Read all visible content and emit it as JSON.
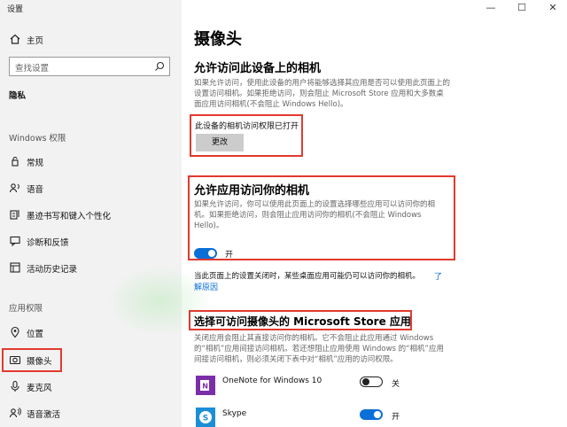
{
  "window": {
    "title": "设置",
    "minimize": "—",
    "maximize": "☐",
    "close": "✕"
  },
  "sidebar": {
    "home": "主页",
    "search_placeholder": "查找设置",
    "section_privacy": "隐私",
    "group_windows": "Windows 权限",
    "windows_items": [
      "常规",
      "语音",
      "墨迹书写和键入个性化",
      "诊断和反馈",
      "活动历史记录"
    ],
    "group_app": "应用权限",
    "app_items": [
      "位置",
      "摄像头",
      "麦克风",
      "语音激活"
    ]
  },
  "main": {
    "title": "摄像头",
    "device_heading": "允许访问此设备上的相机",
    "device_desc": "如果允许访问，使用此设备的用户将能够选择其应用是否可以使用此页面上的设置访问相机。如果拒绝访问，则会阻止 Microsoft Store 应用和大多数桌面应用访问相机(不会阻止 Windows Hello)。",
    "device_status": "此设备的相机访问权限已打开",
    "change_button": "更改",
    "apps_heading": "允许应用访问你的相机",
    "apps_desc": "如果允许访问，你可以使用此页面上的设置选择哪些应用可以访问你的相机。如果拒绝访问，则会阻止应用访问你的相机(不会阻止 Windows Hello)。",
    "apps_toggle_label": "开",
    "note_text": "当此页面上的设置关闭时，某些桌面应用可能仍可以访问你的相机。",
    "note_link_1": "了",
    "note_link_2": "解原因",
    "store_heading": "选择可访问摄像头的 Microsoft Store 应用",
    "store_desc": "关闭应用会阻止其直接访问你的相机。它不会阻止此应用通过 Windows 的“相机”应用间接访问相机。若还想阻止应用使用 Windows 的“相机”应用间接访问相机，则必须关闭下表中对“相机”应用的访问权限。",
    "apps": [
      {
        "name": "OneNote for Windows 10",
        "state": "关"
      },
      {
        "name": "Skype",
        "state": "开"
      }
    ]
  },
  "colors": {
    "accent": "#0a6fd6",
    "highlight_box": "#e23a2e",
    "sidebar_bg": "#f2f2f2",
    "onenote": "#7a2fa8",
    "skype": "#1a8fd8"
  }
}
